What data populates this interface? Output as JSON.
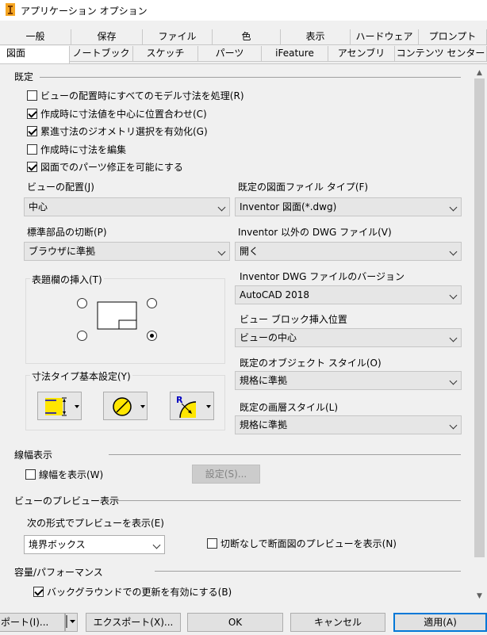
{
  "window": {
    "title": "アプリケーション オプション",
    "icon": "inventor-app-icon",
    "accent_color": "#0078d7"
  },
  "tabs_row1": [
    "一般",
    "保存",
    "ファイル",
    "色",
    "表示",
    "ハードウェア",
    "プロンプト"
  ],
  "tabs_row2": [
    "図面",
    "ノートブック",
    "スケッチ",
    "パーツ",
    "iFeature",
    "アセンブリ",
    "コンテンツ センター"
  ],
  "active_tab": "図面",
  "defaults_section": {
    "title": "既定",
    "checkboxes": [
      {
        "label": "ビューの配置時にすべてのモデル寸法を処理(R)",
        "checked": false
      },
      {
        "label": "作成時に寸法値を中心に位置合わせ(C)",
        "checked": true
      },
      {
        "label": "累進寸法のジオメトリ選択を有効化(G)",
        "checked": true
      },
      {
        "label": "作成時に寸法を編集",
        "checked": false
      },
      {
        "label": "図面でのパーツ修正を可能にする",
        "checked": true
      }
    ]
  },
  "left_fields": {
    "view_placement": {
      "label": "ビューの配置(J)",
      "value": "中心"
    },
    "standard_parts_section": {
      "label": "標準部品の切断(P)",
      "value": "ブラウザに準拠"
    }
  },
  "right_fields": {
    "default_drawing_file_type": {
      "label": "既定の図面ファイル タイプ(F)",
      "value": "Inventor 図面(*.dwg)"
    },
    "non_inventor_dwg": {
      "label": "Inventor 以外の DWG ファイル(V)",
      "value": "開く"
    },
    "dwg_version": {
      "label": "Inventor DWG ファイルのバージョン",
      "value": "AutoCAD 2018"
    },
    "view_block_insertion": {
      "label": "ビュー ブロック挿入位置",
      "value": "ビューの中心"
    },
    "default_object_style": {
      "label": "既定のオブジェクト スタイル(O)",
      "value": "規格に準拠"
    },
    "default_layer_style": {
      "label": "既定の画層スタイル(L)",
      "value": "規格に準拠"
    }
  },
  "title_block": {
    "label": "表題欄の挿入(T)",
    "selected_corner": "bottom-right"
  },
  "dimension_type": {
    "label": "寸法タイプ基本設定(Y)",
    "buttons": [
      "linear-dimension-icon",
      "diameter-dimension-icon",
      "radius-dimension-icon"
    ]
  },
  "lineweight": {
    "title": "線幅表示",
    "show_label": "線幅を表示(W)",
    "show_checked": false,
    "settings_button": "設定(S)..."
  },
  "view_preview": {
    "title": "ビューのプレビュー表示",
    "mode_label": "次の形式でプレビューを表示(E)",
    "mode_value": "境界ボックス",
    "section_preview_label": "切断なしで断面図のプレビューを表示(N)",
    "section_preview_checked": false
  },
  "performance": {
    "title": "容量/パフォーマンス",
    "background_update_label": "バックグラウンドでの更新を有効にする(B)",
    "background_update_checked": true
  },
  "footer": {
    "import_label": "ポート(I)...",
    "export_label": "エクスポート(X)...",
    "ok_label": "OK",
    "cancel_label": "キャンセル",
    "apply_label": "適用(A)"
  }
}
